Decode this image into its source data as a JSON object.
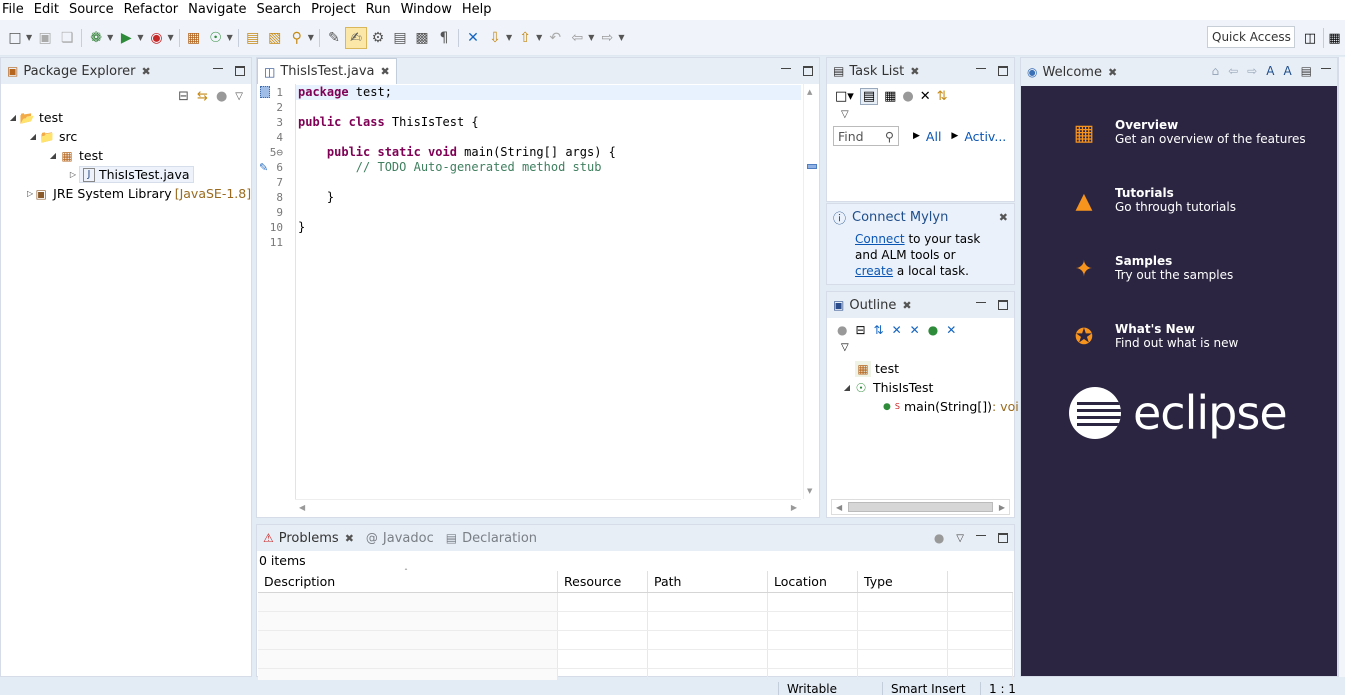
{
  "menu": [
    "File",
    "Edit",
    "Source",
    "Refactor",
    "Navigate",
    "Search",
    "Project",
    "Run",
    "Window",
    "Help"
  ],
  "toolbar": {
    "quick_access": "Quick Access"
  },
  "package_explorer": {
    "tab": "Package Explorer",
    "tree": [
      {
        "label": "test",
        "icon": "project-icon",
        "depth": 0,
        "expanded": true
      },
      {
        "label": "src",
        "icon": "source-folder-icon",
        "depth": 1,
        "expanded": true
      },
      {
        "label": "test",
        "icon": "package-icon",
        "depth": 2,
        "expanded": true
      },
      {
        "label": "ThisIsTest.java",
        "icon": "java-file-icon",
        "depth": 3,
        "expanded": false,
        "selected": true
      },
      {
        "label": "JRE System Library",
        "suffix": "[JavaSE-1.8]",
        "icon": "library-icon",
        "depth": 1,
        "expanded": false
      }
    ]
  },
  "editor": {
    "tab": "ThisIsTest.java",
    "lines": [
      {
        "n": "1",
        "tokens": [
          [
            "kw",
            "package"
          ],
          [
            "",
            " test;"
          ]
        ]
      },
      {
        "n": "2",
        "tokens": []
      },
      {
        "n": "3",
        "tokens": [
          [
            "kw",
            "public class"
          ],
          [
            "",
            " ThisIsTest {"
          ]
        ]
      },
      {
        "n": "4",
        "tokens": []
      },
      {
        "n": "5⊖",
        "tokens": [
          [
            "",
            "    "
          ],
          [
            "kw",
            "public static void"
          ],
          [
            "",
            " main(String[] args) {"
          ]
        ]
      },
      {
        "n": "6",
        "tokens": [
          [
            "cm",
            "        // TODO Auto-generated method stub"
          ]
        ]
      },
      {
        "n": "7",
        "tokens": []
      },
      {
        "n": "8",
        "tokens": [
          [
            "",
            "    }"
          ]
        ]
      },
      {
        "n": "9",
        "tokens": []
      },
      {
        "n": "10",
        "tokens": [
          [
            "",
            "}"
          ]
        ]
      },
      {
        "n": "11",
        "tokens": []
      }
    ]
  },
  "task_list": {
    "tab": "Task List",
    "find_placeholder": "Find",
    "filter_all": "All",
    "filter_active": "Activ..."
  },
  "mylyn": {
    "title": "Connect Mylyn",
    "connect": "Connect",
    "text1": " to your task and ALM tools or ",
    "create": "create",
    "text2": " a local task."
  },
  "outline": {
    "tab": "Outline",
    "items": [
      {
        "label": "test",
        "icon": "package-icon"
      },
      {
        "label": "ThisIsTest",
        "icon": "class-icon"
      },
      {
        "label": "main(String[])",
        "suffix": " : voi",
        "icon": "method-icon"
      }
    ]
  },
  "welcome": {
    "tab": "Welcome",
    "items": [
      {
        "title": "Overview",
        "desc": "Get an overview of the features",
        "icon": "map-icon"
      },
      {
        "title": "Tutorials",
        "desc": "Go through tutorials",
        "icon": "graduation-cap-icon"
      },
      {
        "title": "Samples",
        "desc": "Try out the samples",
        "icon": "magic-wand-icon"
      },
      {
        "title": "What's New",
        "desc": "Find out what is new",
        "icon": "star-icon"
      }
    ],
    "logo_text": "eclipse"
  },
  "bottom": {
    "tabs": [
      "Problems",
      "Javadoc",
      "Declaration"
    ],
    "items_count": "0 items",
    "columns": [
      "Description",
      "Resource",
      "Path",
      "Location",
      "Type"
    ]
  },
  "status": {
    "writable": "Writable",
    "insert_mode": "Smart Insert",
    "position": "1 : 1"
  },
  "colors": {
    "welcome_bg": "#2c2541",
    "welcome_accent": "#f7941e",
    "keyword": "#7f0055",
    "comment": "#3f7f5f"
  }
}
